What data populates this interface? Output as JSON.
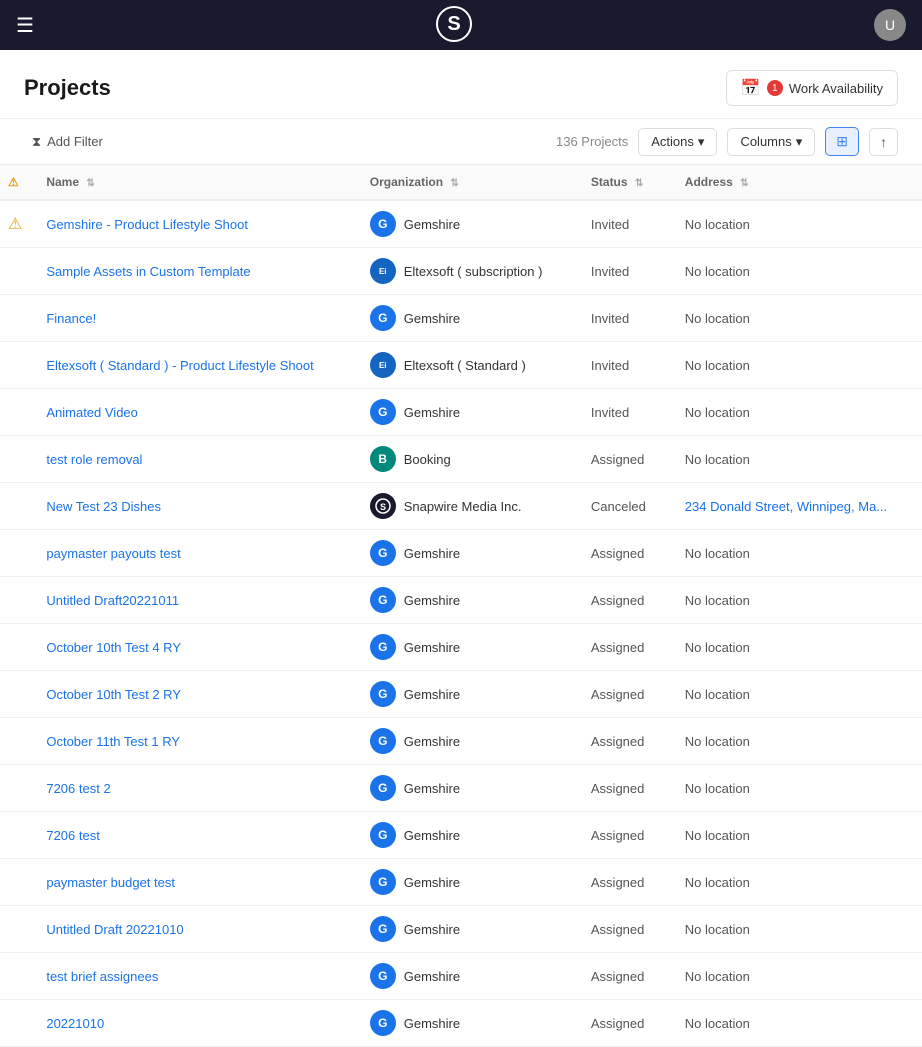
{
  "nav": {
    "hamburger_label": "☰",
    "logo_symbol": "S",
    "avatar_label": "U"
  },
  "page": {
    "title": "Projects",
    "work_availability_label": "Work Availability",
    "work_availability_badge": "1"
  },
  "toolbar": {
    "add_filter_label": "Add Filter",
    "project_count": "136 Projects",
    "actions_label": "Actions",
    "columns_label": "Columns",
    "grid_icon": "⊞",
    "export_icon": "⇧"
  },
  "table": {
    "columns": [
      {
        "key": "name",
        "label": "Name"
      },
      {
        "key": "organization",
        "label": "Organization"
      },
      {
        "key": "status",
        "label": "Status"
      },
      {
        "key": "address",
        "label": "Address"
      }
    ],
    "rows": [
      {
        "name": "Gemshire - Product Lifestyle Shoot",
        "org": "Gemshire",
        "org_type": "G",
        "org_color": "blue",
        "status": "Invited",
        "address": "No location"
      },
      {
        "name": "Sample Assets in Custom Template",
        "org": "Eltexsoft ( subscription )",
        "org_type": "E",
        "org_color": "eltexsoft",
        "status": "Invited",
        "address": "No location"
      },
      {
        "name": "Finance!",
        "org": "Gemshire",
        "org_type": "G",
        "org_color": "blue",
        "status": "Invited",
        "address": "No location"
      },
      {
        "name": "Eltexsoft ( Standard ) - Product Lifestyle Shoot",
        "org": "Eltexsoft ( Standard )",
        "org_type": "E",
        "org_color": "eltexsoft",
        "status": "Invited",
        "address": "No location"
      },
      {
        "name": "Animated Video",
        "org": "Gemshire",
        "org_type": "G",
        "org_color": "blue",
        "status": "Invited",
        "address": "No location"
      },
      {
        "name": "test role removal",
        "org": "Booking",
        "org_type": "B",
        "org_color": "teal",
        "status": "Assigned",
        "address": "No location"
      },
      {
        "name": "New Test 23 Dishes",
        "org": "Snapwire Media Inc.",
        "org_type": "S",
        "org_color": "snapwire",
        "status": "Canceled",
        "address": "234 Donald Street, Winnipeg, Ma..."
      },
      {
        "name": "paymaster payouts test",
        "org": "Gemshire",
        "org_type": "G",
        "org_color": "blue",
        "status": "Assigned",
        "address": "No location"
      },
      {
        "name": "Untitled Draft20221011",
        "org": "Gemshire",
        "org_type": "G",
        "org_color": "blue",
        "status": "Assigned",
        "address": "No location"
      },
      {
        "name": "October 10th Test 4 RY",
        "org": "Gemshire",
        "org_type": "G",
        "org_color": "blue",
        "status": "Assigned",
        "address": "No location"
      },
      {
        "name": "October 10th Test 2 RY",
        "org": "Gemshire",
        "org_type": "G",
        "org_color": "blue",
        "status": "Assigned",
        "address": "No location"
      },
      {
        "name": "October 11th Test 1 RY",
        "org": "Gemshire",
        "org_type": "G",
        "org_color": "blue",
        "status": "Assigned",
        "address": "No location"
      },
      {
        "name": "7206 test 2",
        "org": "Gemshire",
        "org_type": "G",
        "org_color": "blue",
        "status": "Assigned",
        "address": "No location"
      },
      {
        "name": "7206 test",
        "org": "Gemshire",
        "org_type": "G",
        "org_color": "blue",
        "status": "Assigned",
        "address": "No location"
      },
      {
        "name": "paymaster budget test",
        "org": "Gemshire",
        "org_type": "G",
        "org_color": "blue",
        "status": "Assigned",
        "address": "No location"
      },
      {
        "name": "Untitled Draft 20221010",
        "org": "Gemshire",
        "org_type": "G",
        "org_color": "blue",
        "status": "Assigned",
        "address": "No location"
      },
      {
        "name": "test brief assignees",
        "org": "Gemshire",
        "org_type": "G",
        "org_color": "blue",
        "status": "Assigned",
        "address": "No location"
      },
      {
        "name": "20221010",
        "org": "Gemshire",
        "org_type": "G",
        "org_color": "blue",
        "status": "Assigned",
        "address": "No location"
      }
    ]
  },
  "colors": {
    "blue_org": "#1a73e8",
    "teal_org": "#00897b",
    "dark_org": "#1a1a2e",
    "address_link": "#1a73e8",
    "canceled_address": "234 Donald Street, Winnipeg, Ma..."
  }
}
